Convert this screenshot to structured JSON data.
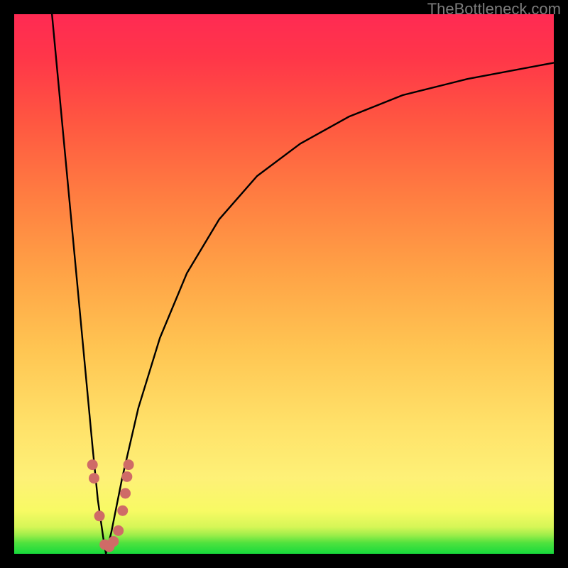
{
  "watermark": "TheBottleneck.com",
  "colors": {
    "frame": "#000000",
    "gradient_top": "#ff2a53",
    "gradient_bottom": "#17da3c",
    "curve": "#000000",
    "marker": "#cf6b67"
  },
  "chart_data": {
    "type": "line",
    "title": "",
    "xlabel": "",
    "ylabel": "",
    "xlim": [
      0,
      100
    ],
    "ylim": [
      0,
      100
    ],
    "grid": false,
    "legend": false,
    "description": "Bottleneck curve: a steep V-shaped curve dipping to near zero around x≈17 then rising asymptotically; scattered data points cluster near the dip.",
    "series": [
      {
        "name": "left-branch",
        "x": [
          7.0,
          8.5,
          10.0,
          11.5,
          13.0,
          14.5,
          15.5,
          16.5,
          17.0
        ],
        "y": [
          100,
          84,
          68,
          52,
          36,
          20,
          10,
          3,
          0
        ]
      },
      {
        "name": "right-branch",
        "x": [
          17.0,
          18.0,
          20.0,
          23.0,
          27.0,
          32.0,
          38.0,
          45.0,
          53.0,
          62.0,
          72.0,
          84.0,
          100.0
        ],
        "y": [
          0,
          4,
          14,
          27,
          40,
          52,
          62,
          70,
          76,
          81,
          85,
          88,
          91
        ]
      }
    ],
    "markers": [
      {
        "x": 14.5,
        "y": 16.5
      },
      {
        "x": 14.8,
        "y": 14.0
      },
      {
        "x": 15.8,
        "y": 7.0
      },
      {
        "x": 16.8,
        "y": 1.7
      },
      {
        "x": 17.6,
        "y": 1.3
      },
      {
        "x": 18.4,
        "y": 2.3
      },
      {
        "x": 19.3,
        "y": 4.3
      },
      {
        "x": 20.1,
        "y": 8.0
      },
      {
        "x": 20.6,
        "y": 11.2
      },
      {
        "x": 20.9,
        "y": 14.3
      },
      {
        "x": 21.2,
        "y": 16.5
      }
    ],
    "marker_radius_px": 7
  }
}
